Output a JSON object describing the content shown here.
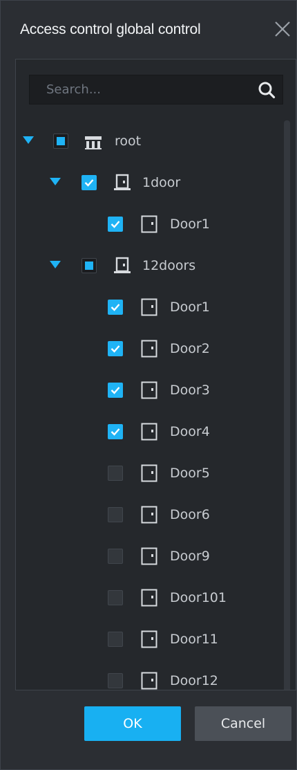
{
  "dialog": {
    "title": "Access control global control",
    "search": {
      "placeholder": "Search...",
      "value": ""
    },
    "buttons": {
      "ok": "OK",
      "cancel": "Cancel"
    }
  },
  "tree": [
    {
      "label": "root",
      "level": 0,
      "type": "root",
      "check": "partial",
      "expanded": true
    },
    {
      "label": "1door",
      "level": 1,
      "type": "controller",
      "check": "checked",
      "expanded": true
    },
    {
      "label": "Door1",
      "level": 2,
      "type": "door",
      "check": "checked"
    },
    {
      "label": "12doors",
      "level": 1,
      "type": "controller",
      "check": "partial",
      "expanded": true
    },
    {
      "label": "Door1",
      "level": 2,
      "type": "door",
      "check": "checked"
    },
    {
      "label": "Door2",
      "level": 2,
      "type": "door",
      "check": "checked"
    },
    {
      "label": "Door3",
      "level": 2,
      "type": "door",
      "check": "checked"
    },
    {
      "label": "Door4",
      "level": 2,
      "type": "door",
      "check": "checked"
    },
    {
      "label": "Door5",
      "level": 2,
      "type": "door",
      "check": "unchecked"
    },
    {
      "label": "Door6",
      "level": 2,
      "type": "door",
      "check": "unchecked"
    },
    {
      "label": "Door9",
      "level": 2,
      "type": "door",
      "check": "unchecked"
    },
    {
      "label": "Door101",
      "level": 2,
      "type": "door",
      "check": "unchecked"
    },
    {
      "label": "Door11",
      "level": 2,
      "type": "door",
      "check": "unchecked"
    },
    {
      "label": "Door12",
      "level": 2,
      "type": "door",
      "check": "unchecked"
    }
  ],
  "icons": {
    "close": "close-icon",
    "search": "search-icon",
    "expand": "triangle-down-icon",
    "root": "building-icon",
    "controller": "door-controller-icon",
    "door": "door-icon"
  },
  "colors": {
    "accent": "#1fb3f5",
    "dialog_bg": "#2b2e33",
    "panel_bg": "#25282c",
    "text": "#c8ccd1",
    "cancel_bg": "#4b5057"
  }
}
